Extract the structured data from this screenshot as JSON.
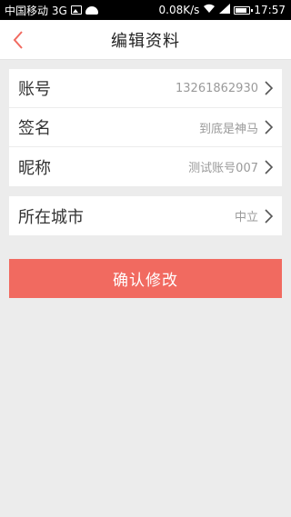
{
  "status_bar": {
    "carrier": "中国移动 3G",
    "net_speed": "0.08K/s",
    "time": "17:57"
  },
  "nav": {
    "title": "编辑资料"
  },
  "profile": {
    "rows": [
      {
        "label": "账号",
        "value": "13261862930"
      },
      {
        "label": "签名",
        "value": "到底是神马"
      },
      {
        "label": "昵称",
        "value": "测试账号007"
      }
    ]
  },
  "location": {
    "label": "所在城市",
    "value": "中立"
  },
  "actions": {
    "confirm_label": "确认修改"
  },
  "colors": {
    "accent": "#f16a60",
    "background": "#ececec"
  }
}
